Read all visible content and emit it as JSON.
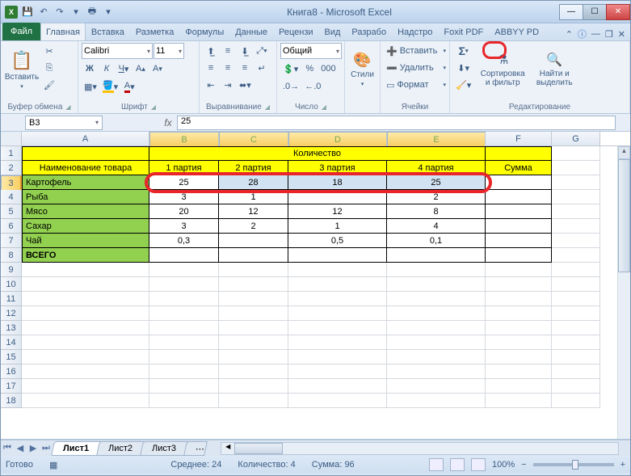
{
  "window": {
    "title": "Книга8 - Microsoft Excel"
  },
  "qat_icons": [
    "excel",
    "save",
    "undo",
    "redo",
    "print",
    "new"
  ],
  "file_tab": "Файл",
  "tabs": [
    "Главная",
    "Вставка",
    "Разметка",
    "Формулы",
    "Данные",
    "Рецензи",
    "Вид",
    "Разрабо",
    "Надстро",
    "Foxit PDF",
    "ABBYY PD"
  ],
  "active_tab": 0,
  "help_icons": [
    "minimize-ribbon",
    "help"
  ],
  "ribbon": {
    "clipboard": {
      "label": "Буфер обмена",
      "paste": "Вставить"
    },
    "font": {
      "label": "Шрифт",
      "name": "Calibri",
      "size": "11"
    },
    "alignment": {
      "label": "Выравнивание"
    },
    "number": {
      "label": "Число",
      "format": "Общий"
    },
    "styles": {
      "label": "",
      "btn": "Стили"
    },
    "cells": {
      "label": "Ячейки",
      "insert": "Вставить",
      "delete": "Удалить",
      "format": "Формат"
    },
    "editing": {
      "label": "Редактирование",
      "autosum": "Σ",
      "sort": "Сортировка и фильтр",
      "find": "Найти и выделить"
    }
  },
  "namebox": "B3",
  "formula": "25",
  "cols": [
    {
      "name": "A",
      "w": 158
    },
    {
      "name": "B",
      "w": 86
    },
    {
      "name": "C",
      "w": 86
    },
    {
      "name": "D",
      "w": 122
    },
    {
      "name": "E",
      "w": 122
    },
    {
      "name": "F",
      "w": 82
    },
    {
      "name": "G",
      "w": 60
    }
  ],
  "selected_cols": [
    "B",
    "C",
    "D",
    "E"
  ],
  "selected_row": 3,
  "grid": {
    "r1": {
      "A": "",
      "qty_header": "Количество",
      "F": ""
    },
    "r2": {
      "A": "Наименование товара",
      "B": "1 партия",
      "C": "2 партия",
      "D": "3 партия",
      "E": "4 партия",
      "F": "Сумма"
    },
    "r3": {
      "A": "Картофель",
      "B": "25",
      "C": "28",
      "D": "18",
      "E": "25"
    },
    "r4": {
      "A": "Рыба",
      "B": "3",
      "C": "1",
      "D": "",
      "E": "2"
    },
    "r5": {
      "A": "Мясо",
      "B": "20",
      "C": "12",
      "D": "12",
      "E": "8"
    },
    "r6": {
      "A": "Сахар",
      "B": "3",
      "C": "2",
      "D": "1",
      "E": "4"
    },
    "r7": {
      "A": "Чай",
      "B": "0,3",
      "C": "",
      "D": "0,5",
      "E": "0,1"
    },
    "r8": {
      "A": "ВСЕГО"
    }
  },
  "blank_rows": [
    9,
    10,
    11,
    12,
    13,
    14,
    15,
    16,
    17,
    18
  ],
  "sheets": {
    "tabs": [
      "Лист1",
      "Лист2",
      "Лист3"
    ],
    "active": 0
  },
  "status": {
    "ready": "Готово",
    "avg_label": "Среднее:",
    "avg": "24",
    "count_label": "Количество:",
    "count": "4",
    "sum_label": "Сумма:",
    "sum": "96",
    "zoom": "100%"
  },
  "chart_data": {
    "type": "table",
    "title": "Количество",
    "columns": [
      "Наименование товара",
      "1 партия",
      "2 партия",
      "3 партия",
      "4 партия",
      "Сумма"
    ],
    "rows": [
      [
        "Картофель",
        25,
        28,
        18,
        25,
        null
      ],
      [
        "Рыба",
        3,
        1,
        null,
        2,
        null
      ],
      [
        "Мясо",
        20,
        12,
        12,
        8,
        null
      ],
      [
        "Сахар",
        3,
        2,
        1,
        4,
        null
      ],
      [
        "Чай",
        0.3,
        null,
        0.5,
        0.1,
        null
      ],
      [
        "ВСЕГО",
        null,
        null,
        null,
        null,
        null
      ]
    ]
  }
}
